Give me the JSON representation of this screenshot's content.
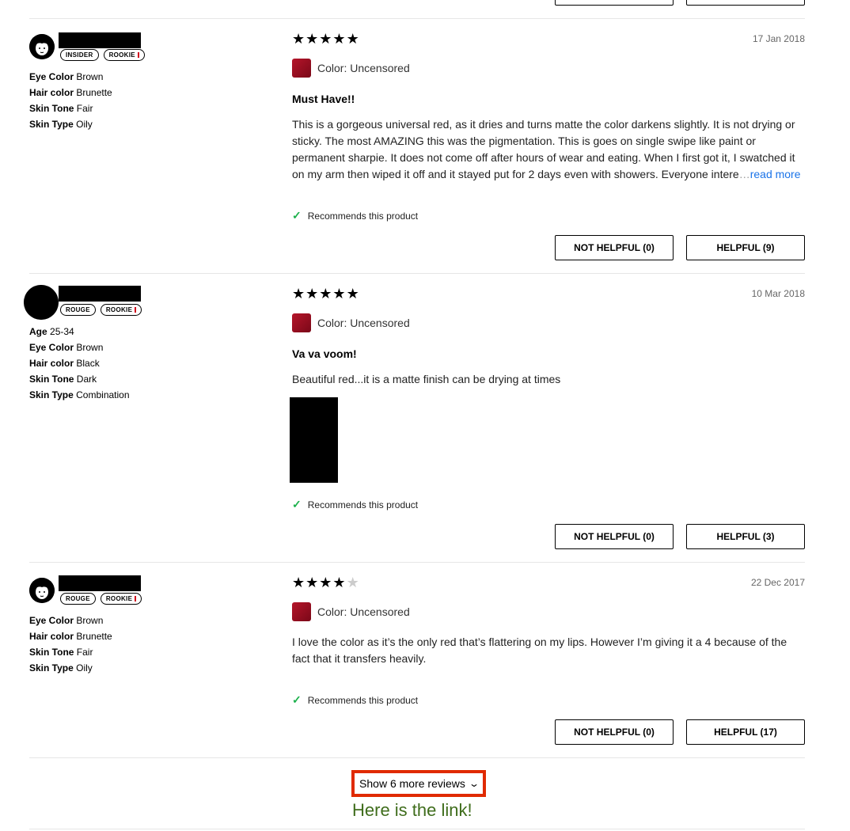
{
  "top": {
    "buttons": [
      "",
      ""
    ]
  },
  "reviews": [
    {
      "avatar": "face-avatar",
      "badges": [
        "INSIDER",
        "ROOKIE"
      ],
      "attributes": [
        {
          "key": "Eye Color",
          "value": "Brown"
        },
        {
          "key": "Hair color",
          "value": "Brunette"
        },
        {
          "key": "Skin Tone",
          "value": "Fair"
        },
        {
          "key": "Skin Type",
          "value": "Oily"
        }
      ],
      "rating": 5,
      "date": "17 Jan 2018",
      "color_label": "Color: Uncensored",
      "title": "Must Have!!",
      "body": "This is a gorgeous universal red, as it dries and turns matte the color darkens slightly. It is not drying or sticky. The most AMAZING this was the pigmentation. This is goes on single swipe like paint or permanent sharpie. It does not come off after hours of wear and eating. When I first got it, I swatched it on my arm then wiped it off and it stayed put for 2 days even with showers. Everyone intere",
      "ellipsis": "…",
      "read_more": "read more",
      "recommend": "Recommends this product",
      "not_helpful": "NOT HELPFUL (0)",
      "helpful": "HELPFUL (9)"
    },
    {
      "avatar": "solid-avatar",
      "badges": [
        "ROUGE",
        "ROOKIE"
      ],
      "attributes": [
        {
          "key": "Age",
          "value": "25-34"
        },
        {
          "key": "Eye Color",
          "value": "Brown"
        },
        {
          "key": "Hair color",
          "value": "Black"
        },
        {
          "key": "Skin Tone",
          "value": "Dark"
        },
        {
          "key": "Skin Type",
          "value": "Combination"
        }
      ],
      "rating": 5,
      "date": "10 Mar 2018",
      "color_label": "Color: Uncensored",
      "title": "Va va voom!",
      "body": "Beautiful red...it is a matte finish can be drying at times",
      "recommend": "Recommends this product",
      "not_helpful": "NOT HELPFUL (0)",
      "helpful": "HELPFUL (3)"
    },
    {
      "avatar": "face-avatar",
      "badges": [
        "ROUGE",
        "ROOKIE"
      ],
      "attributes": [
        {
          "key": "Eye Color",
          "value": "Brown"
        },
        {
          "key": "Hair color",
          "value": "Brunette"
        },
        {
          "key": "Skin Tone",
          "value": "Fair"
        },
        {
          "key": "Skin Type",
          "value": "Oily"
        }
      ],
      "rating": 4,
      "date": "22 Dec 2017",
      "color_label": "Color: Uncensored",
      "body": "I love the color as it’s the only red that’s flattering on my lips. However I’m giving it a 4 because of the fact that it transfers heavily.",
      "recommend": "Recommends this product",
      "not_helpful": "NOT HELPFUL (0)",
      "helpful": "HELPFUL (17)"
    }
  ],
  "show_more": {
    "label": "Show 6 more reviews",
    "icon": "chevron-down-icon"
  },
  "annotation": "Here is the link!",
  "colors": {
    "accent_link": "#1a73e8",
    "check": "#1cb14c",
    "highlight_border": "#e02a00",
    "annotation": "#3f6d1c",
    "swatch": "#a0102a"
  }
}
